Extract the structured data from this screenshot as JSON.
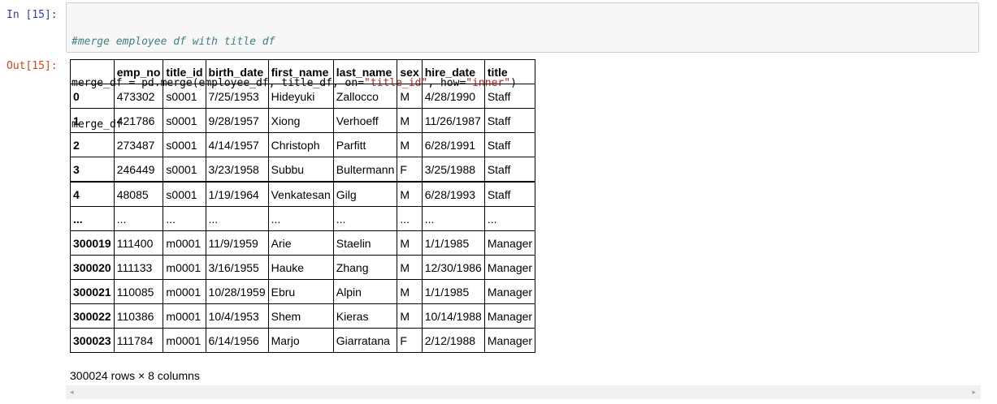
{
  "input_cell": {
    "prompt": "In [15]:",
    "lines": [
      {
        "comment": "#merge employee df with title df"
      },
      {
        "code_a": "merge_df = pd.merge(employee_df, title_df, on=",
        "str_a": "\"title_id\"",
        "code_b": ", how=",
        "str_b": "\"inner\"",
        "code_c": ")"
      },
      {
        "code": "merge_df"
      }
    ]
  },
  "output_cell": {
    "prompt": "Out[15]:",
    "columns": [
      "",
      "emp_no",
      "title_id",
      "birth_date",
      "first_name",
      "last_name",
      "sex",
      "hire_date",
      "title"
    ],
    "rows": [
      [
        "0",
        "473302",
        "s0001",
        "7/25/1953",
        "Hideyuki",
        "Zallocco",
        "M",
        "4/28/1990",
        "Staff"
      ],
      [
        "1",
        "421786",
        "s0001",
        "9/28/1957",
        "Xiong",
        "Verhoeff",
        "M",
        "11/26/1987",
        "Staff"
      ],
      [
        "2",
        "273487",
        "s0001",
        "4/14/1957",
        "Christoph",
        "Parfitt",
        "M",
        "6/28/1991",
        "Staff"
      ],
      [
        "3",
        "246449",
        "s0001",
        "3/23/1958",
        "Subbu",
        "Bultermann",
        "F",
        "3/25/1988",
        "Staff"
      ],
      [
        "4",
        "48085",
        "s0001",
        "1/19/1964",
        "Venkatesan",
        "Gilg",
        "M",
        "6/28/1993",
        "Staff"
      ],
      [
        "...",
        "...",
        "...",
        "...",
        "...",
        "...",
        "...",
        "...",
        "..."
      ],
      [
        "300019",
        "111400",
        "m0001",
        "11/9/1959",
        "Arie",
        "Staelin",
        "M",
        "1/1/1985",
        "Manager"
      ],
      [
        "300020",
        "111133",
        "m0001",
        "3/16/1955",
        "Hauke",
        "Zhang",
        "M",
        "12/30/1986",
        "Manager"
      ],
      [
        "300021",
        "110085",
        "m0001",
        "10/28/1959",
        "Ebru",
        "Alpin",
        "M",
        "1/1/1985",
        "Manager"
      ],
      [
        "300022",
        "110386",
        "m0001",
        "10/4/1953",
        "Shem",
        "Kieras",
        "M",
        "10/14/1988",
        "Manager"
      ],
      [
        "300023",
        "111784",
        "m0001",
        "6/14/1956",
        "Marjo",
        "Giarratana",
        "F",
        "2/12/1988",
        "Manager"
      ]
    ],
    "shape_info": "300024 rows × 8 columns"
  },
  "scrollbar": {
    "left_arrow": "◂",
    "right_arrow": "▸"
  }
}
